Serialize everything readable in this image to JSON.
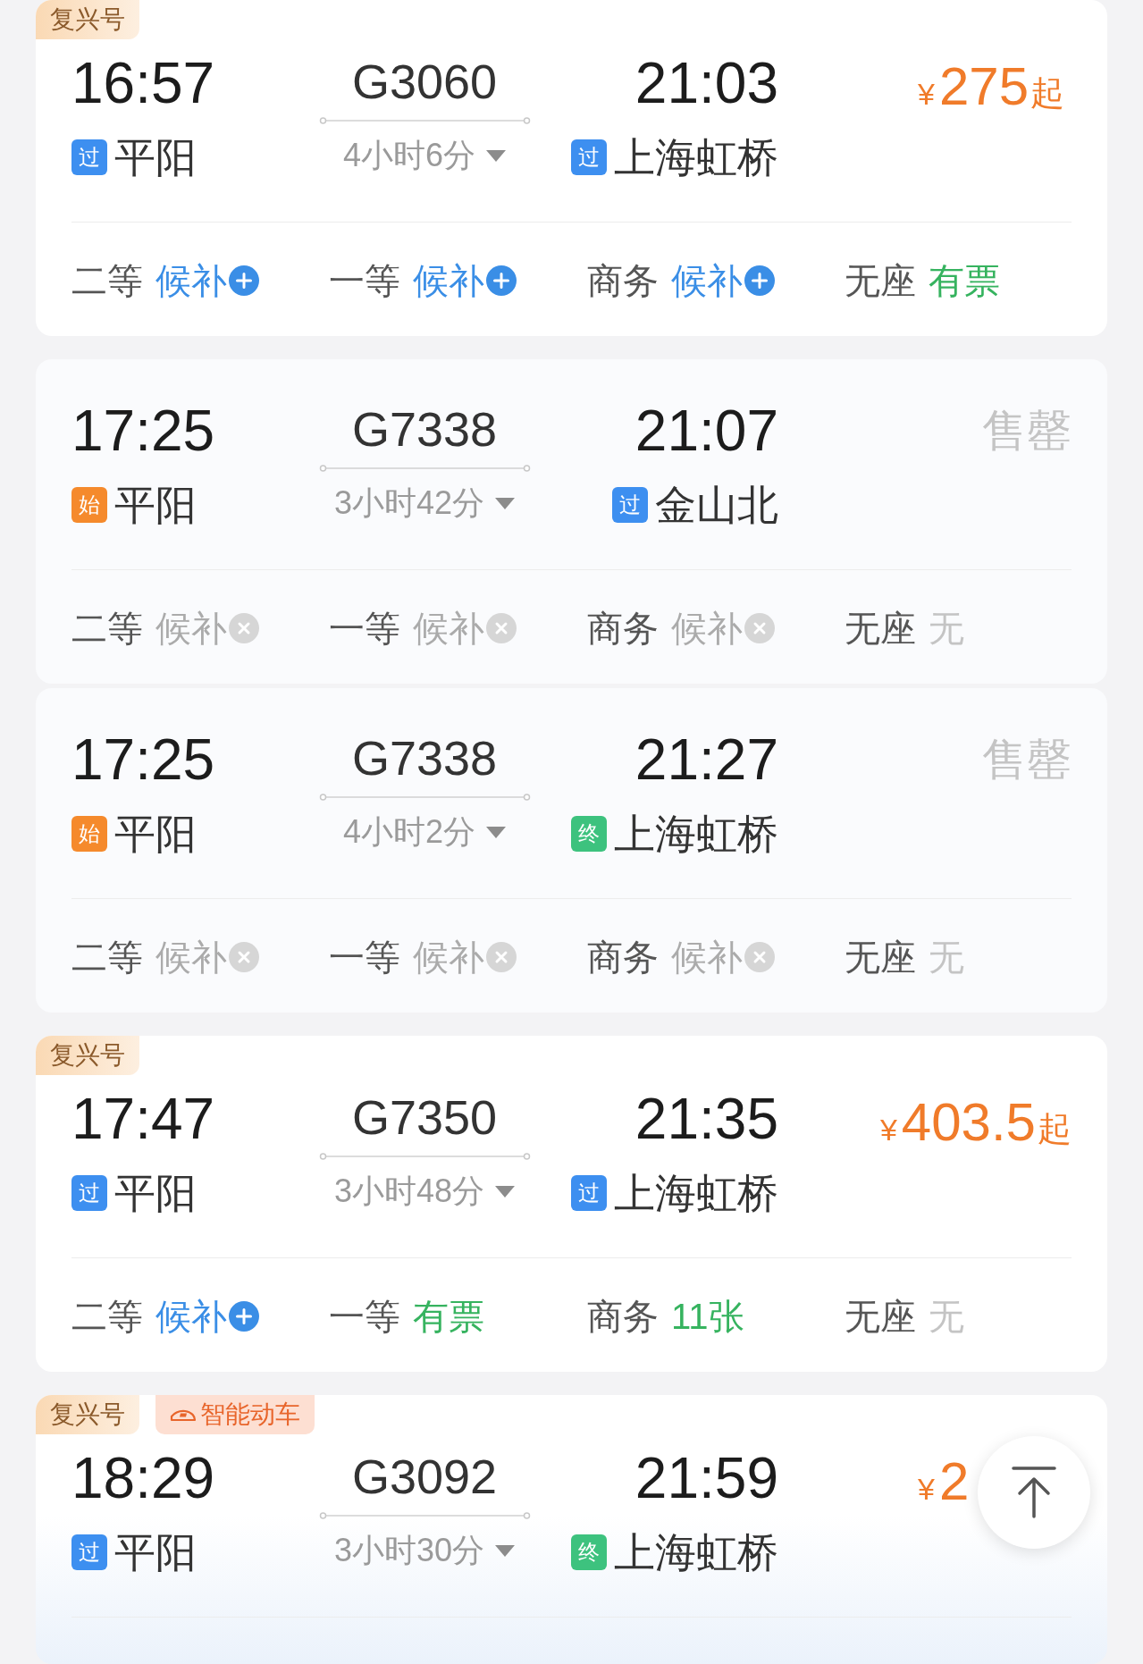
{
  "trains": [
    {
      "tags": [
        {
          "kind": "fuxing",
          "text": "复兴号"
        }
      ],
      "departure": {
        "time": "16:57",
        "badge": {
          "kind": "pass",
          "text": "过"
        },
        "station": "平阳"
      },
      "train_no": "G3060",
      "duration": "4小时6分",
      "arrival": {
        "time": "21:03",
        "badge": {
          "kind": "pass",
          "text": "过"
        },
        "station": "上海虹桥"
      },
      "price": {
        "kind": "price",
        "currency": "¥",
        "amount": "275",
        "suffix": "起"
      },
      "seats": [
        {
          "class": "二等",
          "status": "候补",
          "kind": "waitlist"
        },
        {
          "class": "一等",
          "status": "候补",
          "kind": "waitlist"
        },
        {
          "class": "商务",
          "status": "候补",
          "kind": "waitlist"
        },
        {
          "class": "无座",
          "status": "有票",
          "kind": "available"
        }
      ]
    },
    {
      "departure": {
        "time": "17:25",
        "badge": {
          "kind": "start",
          "text": "始"
        },
        "station": "平阳"
      },
      "train_no": "G7338",
      "duration": "3小时42分",
      "arrival": {
        "time": "21:07",
        "badge": {
          "kind": "pass",
          "text": "过"
        },
        "station": "金山北"
      },
      "price": {
        "kind": "sold_out",
        "text": "售罄"
      },
      "seats": [
        {
          "class": "二等",
          "status": "候补",
          "kind": "waitlist_closed"
        },
        {
          "class": "一等",
          "status": "候补",
          "kind": "waitlist_closed"
        },
        {
          "class": "商务",
          "status": "候补",
          "kind": "waitlist_closed"
        },
        {
          "class": "无座",
          "status": "无",
          "kind": "none"
        }
      ]
    },
    {
      "departure": {
        "time": "17:25",
        "badge": {
          "kind": "start",
          "text": "始"
        },
        "station": "平阳"
      },
      "train_no": "G7338",
      "duration": "4小时2分",
      "arrival": {
        "time": "21:27",
        "badge": {
          "kind": "end",
          "text": "终"
        },
        "station": "上海虹桥"
      },
      "price": {
        "kind": "sold_out",
        "text": "售罄"
      },
      "seats": [
        {
          "class": "二等",
          "status": "候补",
          "kind": "waitlist_closed"
        },
        {
          "class": "一等",
          "status": "候补",
          "kind": "waitlist_closed"
        },
        {
          "class": "商务",
          "status": "候补",
          "kind": "waitlist_closed"
        },
        {
          "class": "无座",
          "status": "无",
          "kind": "none"
        }
      ]
    },
    {
      "tags": [
        {
          "kind": "fuxing",
          "text": "复兴号"
        }
      ],
      "departure": {
        "time": "17:47",
        "badge": {
          "kind": "pass",
          "text": "过"
        },
        "station": "平阳"
      },
      "train_no": "G7350",
      "duration": "3小时48分",
      "arrival": {
        "time": "21:35",
        "badge": {
          "kind": "pass",
          "text": "过"
        },
        "station": "上海虹桥"
      },
      "price": {
        "kind": "price",
        "currency": "¥",
        "amount": "403.5",
        "suffix": "起"
      },
      "seats": [
        {
          "class": "二等",
          "status": "候补",
          "kind": "waitlist"
        },
        {
          "class": "一等",
          "status": "有票",
          "kind": "available"
        },
        {
          "class": "商务",
          "status": "11张",
          "kind": "available"
        },
        {
          "class": "无座",
          "status": "无",
          "kind": "none"
        }
      ]
    },
    {
      "tags": [
        {
          "kind": "fuxing",
          "text": "复兴号"
        },
        {
          "kind": "smart",
          "text": "智能动车"
        }
      ],
      "departure": {
        "time": "18:29",
        "badge": {
          "kind": "pass",
          "text": "过"
        },
        "station": "平阳"
      },
      "train_no": "G3092",
      "duration": "3小时30分",
      "arrival": {
        "time": "21:59",
        "badge": {
          "kind": "end",
          "text": "终"
        },
        "station": "上海虹桥"
      },
      "price": {
        "kind": "price",
        "currency": "¥",
        "amount": "2"
      }
    }
  ],
  "back_to_top": true
}
